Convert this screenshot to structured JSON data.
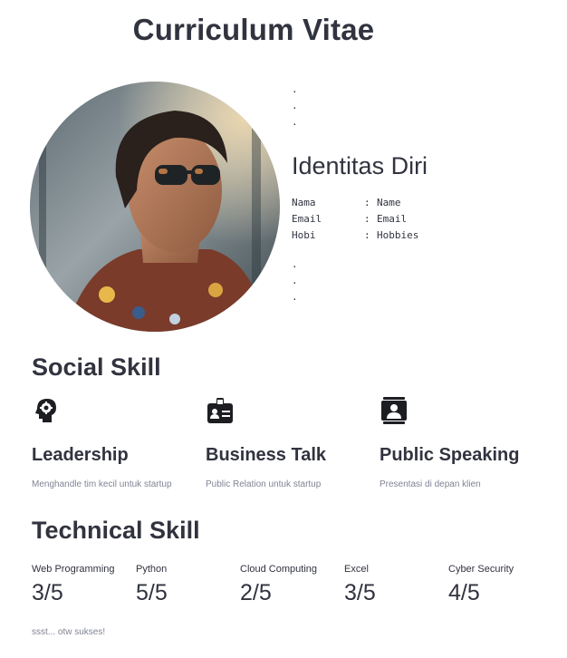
{
  "page": {
    "title": "Curriculum Vitae"
  },
  "identity": {
    "dots_top": ".\n.\n.",
    "heading": "Identitas Diri",
    "rows": [
      {
        "key": "Nama",
        "sep": ":",
        "value": "Name"
      },
      {
        "key": "Email",
        "sep": ":",
        "value": "Email"
      },
      {
        "key": "Hobi",
        "sep": ":",
        "value": "Hobbies"
      }
    ],
    "dots_bottom": ".\n.\n."
  },
  "social": {
    "heading": "Social Skill",
    "skills": [
      {
        "icon": "head-gear-icon",
        "title": "Leadership",
        "desc": "Menghandle tim kecil untuk startup"
      },
      {
        "icon": "id-badge-icon",
        "title": "Business Talk",
        "desc": "Public Relation untuk startup"
      },
      {
        "icon": "contact-book-icon",
        "title": "Public Speaking",
        "desc": "Presentasi di depan klien"
      }
    ]
  },
  "technical": {
    "heading": "Technical Skill",
    "metrics": [
      {
        "label": "Web Programming",
        "value": "3/5"
      },
      {
        "label": "Python",
        "value": "5/5"
      },
      {
        "label": "Cloud Computing",
        "value": "2/5"
      },
      {
        "label": "Excel",
        "value": "3/5"
      },
      {
        "label": "Cyber Security",
        "value": "4/5"
      }
    ],
    "footer": "ssst... otw sukses!"
  },
  "colors": {
    "text": "#31333f",
    "muted": "#808495"
  }
}
